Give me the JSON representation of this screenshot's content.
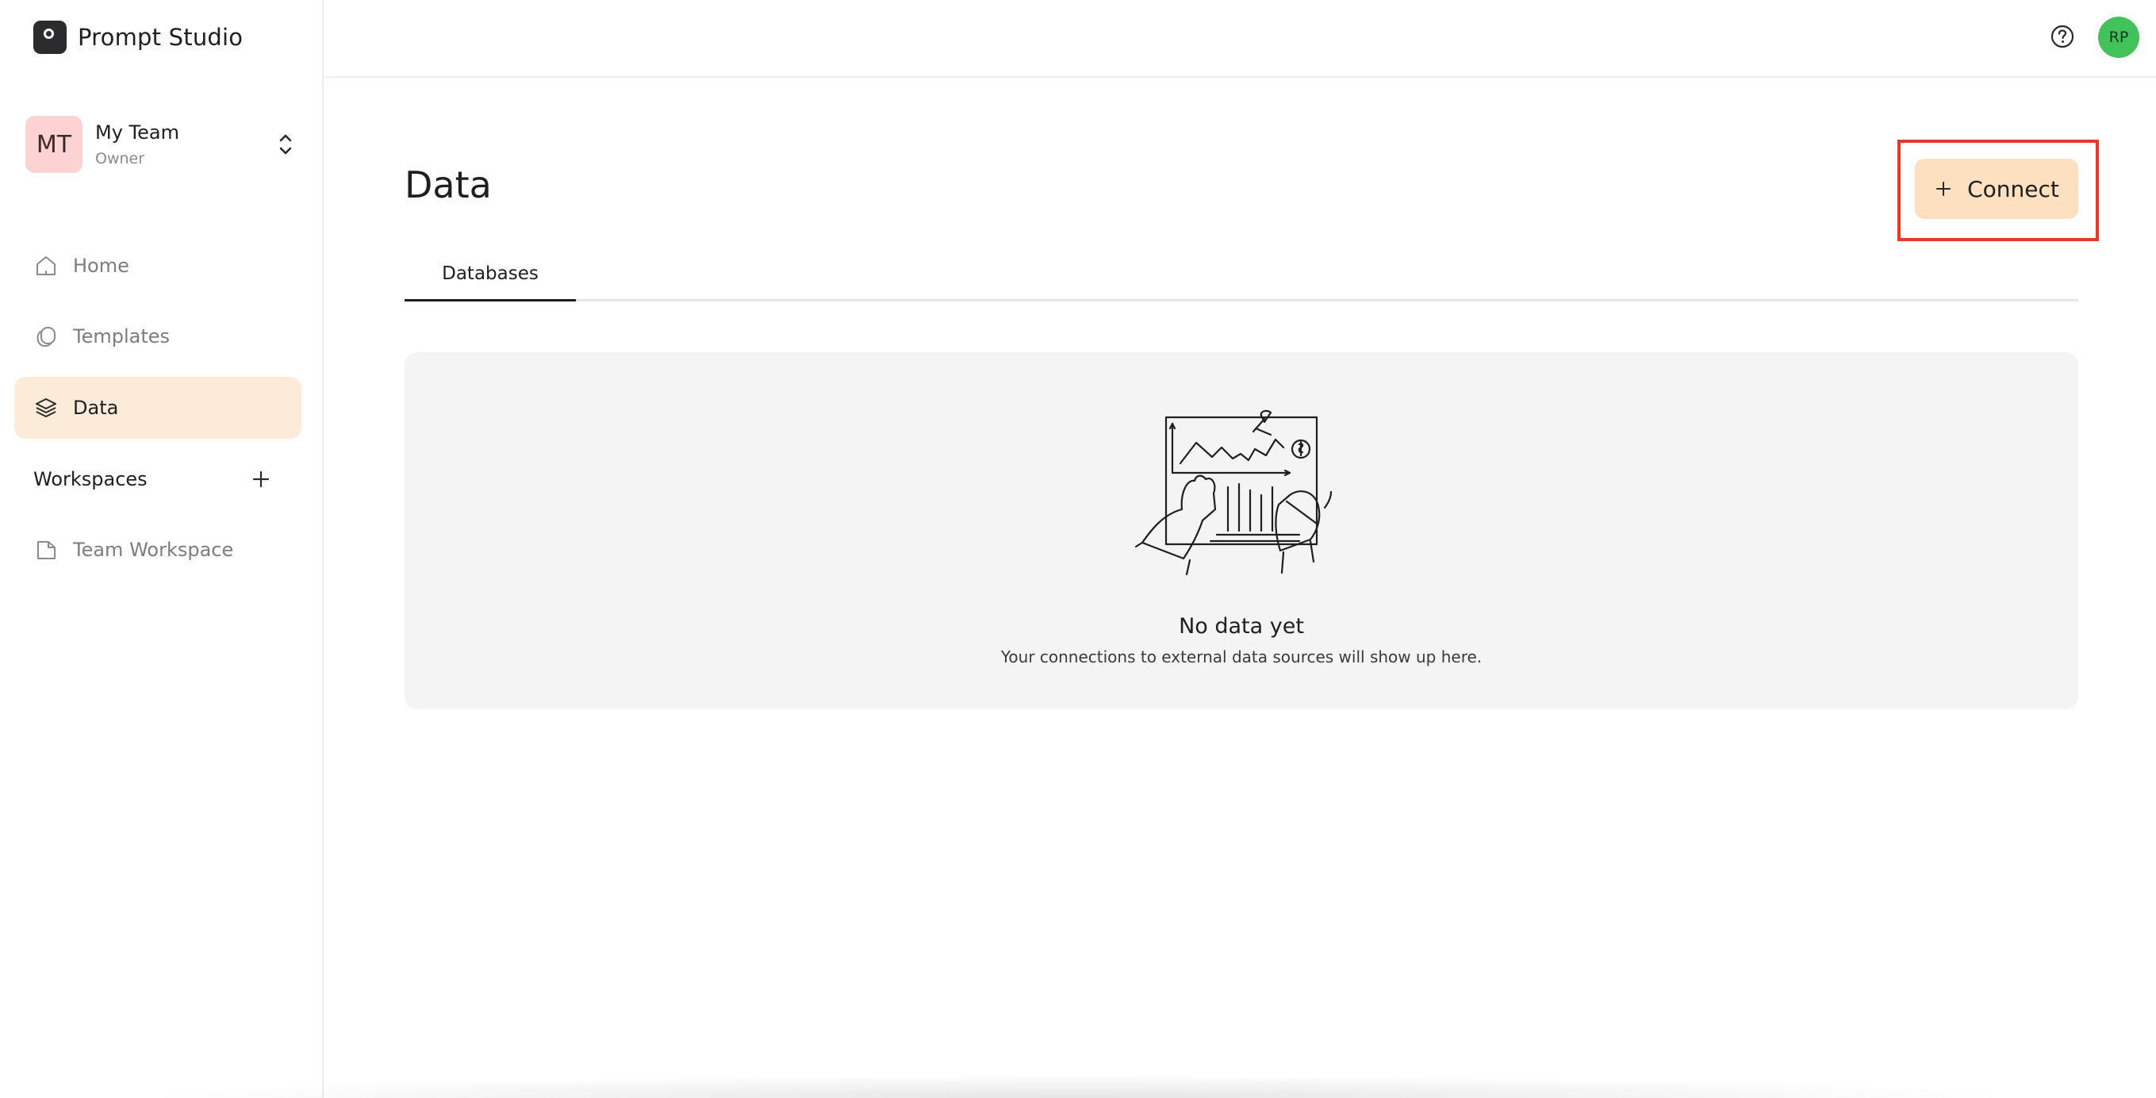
{
  "app": {
    "name": "Prompt Studio"
  },
  "team": {
    "initials": "MT",
    "name": "My Team",
    "role": "Owner"
  },
  "nav": {
    "items": [
      {
        "label": "Home",
        "icon": "home-icon"
      },
      {
        "label": "Templates",
        "icon": "templates-icon"
      },
      {
        "label": "Data",
        "icon": "layers-icon",
        "active": true
      }
    ]
  },
  "workspaces": {
    "label": "Workspaces",
    "items": [
      {
        "label": "Team Workspace",
        "icon": "workspace-icon"
      }
    ]
  },
  "header": {
    "help_icon": "help-circle-icon",
    "user_initials": "RP"
  },
  "main": {
    "title": "Data",
    "connect_label": "Connect",
    "tabs": [
      {
        "label": "Databases",
        "active": true
      }
    ],
    "empty": {
      "title": "No data yet",
      "subtitle": "Your connections to external data sources will show up here."
    }
  },
  "colors": {
    "active_nav_bg": "#fdebd9",
    "connect_bg": "#fde0c0",
    "highlight": "#e8382b",
    "team_avatar": "#fcd2d2",
    "user_avatar": "#43c15b"
  }
}
